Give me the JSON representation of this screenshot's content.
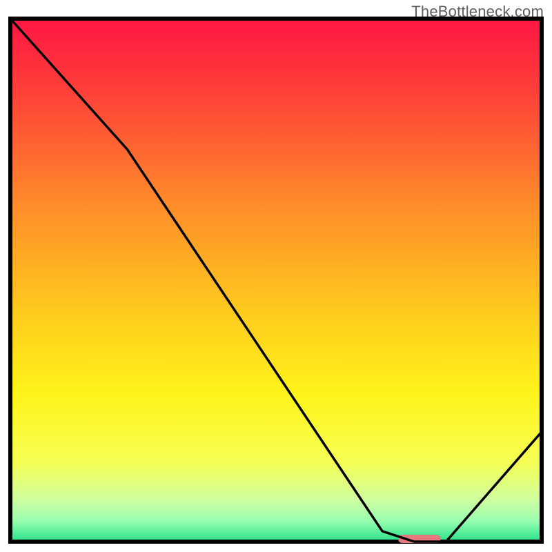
{
  "watermark": "TheBottleneck.com",
  "chart_data": {
    "type": "line",
    "title": "",
    "xlabel": "",
    "ylabel": "",
    "xlim": [
      0,
      100
    ],
    "ylim": [
      0,
      100
    ],
    "x": [
      0,
      22,
      70,
      76,
      82,
      100
    ],
    "values": [
      100,
      75,
      2,
      0,
      0,
      21
    ],
    "marker": {
      "x_start": 73,
      "x_end": 81,
      "y": 0,
      "color": "#e77a7f"
    },
    "gradient_stops": [
      {
        "offset": 0.0,
        "color": "#ff1643"
      },
      {
        "offset": 0.15,
        "color": "#ff4338"
      },
      {
        "offset": 0.35,
        "color": "#ff8a2a"
      },
      {
        "offset": 0.55,
        "color": "#ffc81e"
      },
      {
        "offset": 0.72,
        "color": "#fff41a"
      },
      {
        "offset": 0.85,
        "color": "#f5ff55"
      },
      {
        "offset": 0.92,
        "color": "#cfffa0"
      },
      {
        "offset": 0.96,
        "color": "#9affb0"
      },
      {
        "offset": 1.0,
        "color": "#26e08b"
      }
    ]
  }
}
